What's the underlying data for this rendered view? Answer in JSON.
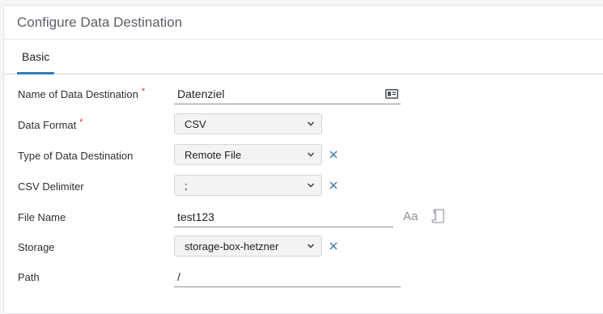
{
  "panel": {
    "title": "Configure Data Destination"
  },
  "tabs": [
    {
      "label": "Basic",
      "active": true
    }
  ],
  "form": {
    "name": {
      "label": "Name of Data Destination",
      "required": "*",
      "value": "Datenziel",
      "icon": "id-card-icon"
    },
    "data_format": {
      "label": "Data Format",
      "required": "*",
      "selected": "CSV"
    },
    "destination_type": {
      "label": "Type of Data Destination",
      "selected": "Remote File",
      "clear_icon": "close-icon"
    },
    "csv_delimiter": {
      "label": "CSV Delimiter",
      "selected": ";",
      "clear_icon": "close-icon"
    },
    "file_name": {
      "label": "File Name",
      "value": "test123",
      "text_icon": "Aa",
      "extra_icon": "document-scroll-icon"
    },
    "storage": {
      "label": "Storage",
      "selected": "storage-box-hetzner",
      "clear_icon": "close-icon"
    },
    "path": {
      "label": "Path",
      "value": "/"
    }
  },
  "colors": {
    "accent": "#3b7bb0",
    "required": "#d0362b",
    "clear": "#3b7bb0"
  }
}
